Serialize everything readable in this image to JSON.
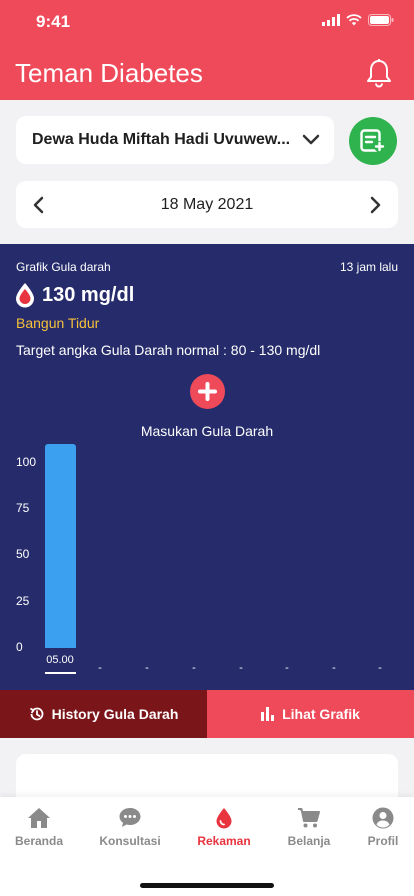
{
  "status_bar": {
    "time": "9:41"
  },
  "header": {
    "title": "Teman Diabetes"
  },
  "patient": {
    "name": "Dewa Huda Miftah Hadi Uvuwew..."
  },
  "date_nav": {
    "date": "18 May 2021"
  },
  "blood_sugar": {
    "label": "Grafik Gula darah",
    "time_ago": "13 jam lalu",
    "value": "130 mg/dl",
    "meal_time": "Bangun Tidur",
    "target": "Target angka Gula Darah normal : 80 - 130 mg/dl",
    "add_label": "Masukan Gula Darah"
  },
  "chart_data": {
    "type": "bar",
    "y_ticks": [
      "100",
      "75",
      "50",
      "25",
      "0"
    ],
    "ylim": [
      0,
      110
    ],
    "categories": [
      "05.00",
      "-",
      "-",
      "-",
      "-",
      "-",
      "-",
      "-"
    ],
    "values": [
      110,
      null,
      null,
      null,
      null,
      null,
      null,
      null
    ],
    "bar_color": "#3ba0f0"
  },
  "tabs": {
    "history": "History Gula Darah",
    "graph": "Lihat Grafik"
  },
  "bottom_nav": {
    "items": [
      {
        "label": "Beranda",
        "icon": "home-icon"
      },
      {
        "label": "Konsultasi",
        "icon": "chat-icon"
      },
      {
        "label": "Rekaman",
        "icon": "blood-drop-icon"
      },
      {
        "label": "Belanja",
        "icon": "cart-icon"
      },
      {
        "label": "Profil",
        "icon": "user-icon"
      }
    ],
    "active_index": 2
  },
  "colors": {
    "primary": "#ef4a5a",
    "panel": "#262c6b",
    "accent_yellow": "#f5c03a",
    "success": "#2fb34e",
    "history_tab": "#7a1519"
  }
}
